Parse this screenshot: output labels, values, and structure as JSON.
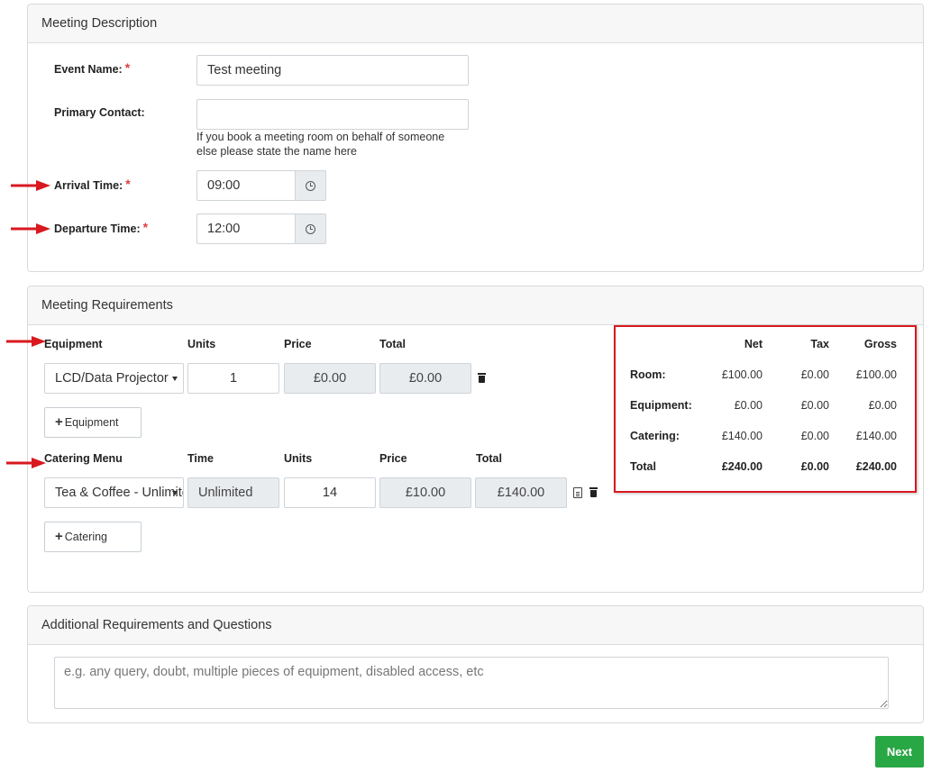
{
  "meeting_description": {
    "heading": "Meeting Description",
    "event_name_label": "Event Name:",
    "event_name_value": "Test meeting",
    "primary_contact_label": "Primary Contact:",
    "primary_contact_value": "",
    "primary_contact_help_line1": "If you book a meeting room on behalf of someone",
    "primary_contact_help_line2": "else please state the name here",
    "arrival_label": "Arrival Time:",
    "arrival_value": "09:00",
    "departure_label": "Departure Time:",
    "departure_value": "12:00",
    "required_marker": "*",
    "clock_icon": "clock-icon"
  },
  "meeting_requirements": {
    "heading": "Meeting Requirements",
    "equipment": {
      "headers": [
        "Equipment",
        "Units",
        "Price",
        "Total"
      ],
      "rows": [
        {
          "item": "LCD/Data Projector",
          "units": "1",
          "price": "£0.00",
          "total": "£0.00"
        }
      ],
      "add_button": "Equipment"
    },
    "catering": {
      "headers": [
        "Catering Menu",
        "Time",
        "Units",
        "Price",
        "Total"
      ],
      "rows": [
        {
          "item": "Tea & Coffee - Unlimited",
          "time": "Unlimited",
          "units": "14",
          "price": "£10.00",
          "total": "£140.00"
        }
      ],
      "add_button": "Catering"
    },
    "summary": {
      "headers": [
        "Net",
        "Tax",
        "Gross"
      ],
      "rows": [
        {
          "label": "Room:",
          "net": "£100.00",
          "tax": "£0.00",
          "gross": "£100.00"
        },
        {
          "label": "Equipment:",
          "net": "£0.00",
          "tax": "£0.00",
          "gross": "£0.00"
        },
        {
          "label": "Catering:",
          "net": "£140.00",
          "tax": "£0.00",
          "gross": "£140.00"
        },
        {
          "label": "Total",
          "net": "£240.00",
          "tax": "£0.00",
          "gross": "£240.00"
        }
      ]
    }
  },
  "additional": {
    "heading": "Additional Requirements and Questions",
    "placeholder": "e.g. any query, doubt, multiple pieces of equipment, disabled access, etc",
    "value": ""
  },
  "next_button": "Next",
  "colors": {
    "accent_green": "#28a745",
    "required_red": "#e03b3b",
    "annotation_red": "#d9181f"
  }
}
